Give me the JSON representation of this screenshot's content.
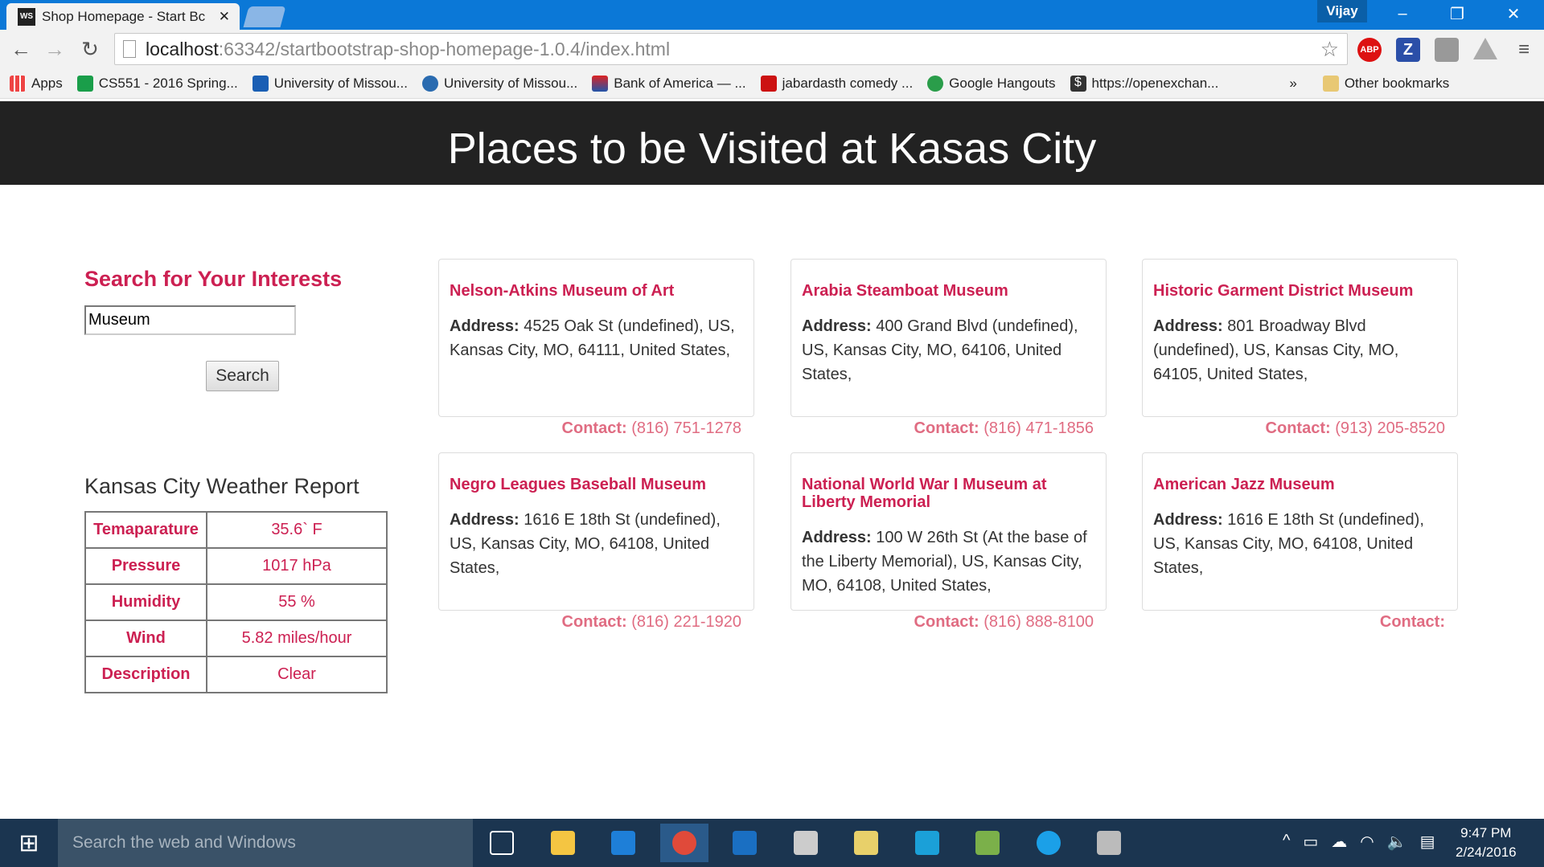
{
  "browser": {
    "tab_title": "Shop Homepage - Start Bc",
    "user": "Vijay",
    "url_host": "localhost",
    "url_path": ":63342/startbootstrap-shop-homepage-1.0.4/index.html",
    "bookmarks": [
      {
        "label": "Apps",
        "color": "#e44"
      },
      {
        "label": "CS551 - 2016 Spring...",
        "color": "#1a9e4a"
      },
      {
        "label": "University of Missou...",
        "color": "#1a5fb4"
      },
      {
        "label": "University of Missou...",
        "color": "#2a6bb0"
      },
      {
        "label": "Bank of America — ...",
        "color": "#d22"
      },
      {
        "label": "jabardasth comedy ...",
        "color": "#c11"
      },
      {
        "label": "Google Hangouts",
        "color": "#2a9d4a"
      },
      {
        "label": "https://openexchan...",
        "color": "#333"
      }
    ],
    "other_bookmarks": "Other bookmarks",
    "extensions": [
      "ABP",
      "Z"
    ]
  },
  "page": {
    "title": "Places to be Visited at Kasas City",
    "search": {
      "heading": "Search for Your Interests",
      "value": "Museum",
      "button": "Search"
    },
    "weather": {
      "heading": "Kansas City Weather Report",
      "rows": [
        [
          "Temaparature",
          "35.6` F"
        ],
        [
          "Pressure",
          "1017 hPa"
        ],
        [
          "Humidity",
          "55 %"
        ],
        [
          "Wind",
          "5.82 miles/hour"
        ],
        [
          "Description",
          "Clear"
        ]
      ]
    },
    "address_label": "Address:",
    "contact_label": "Contact:",
    "places": [
      {
        "name": "Nelson-Atkins Museum of Art",
        "address": "4525 Oak St (undefined), US, Kansas City, MO, 64111, United States,",
        "phone": "(816) 751-1278"
      },
      {
        "name": "Arabia Steamboat Museum",
        "address": "400 Grand Blvd (undefined), US, Kansas City, MO, 64106, United States,",
        "phone": "(816) 471-1856"
      },
      {
        "name": "Historic Garment District Museum",
        "address": "801 Broadway Blvd (undefined), US, Kansas City, MO, 64105, United States,",
        "phone": "(913) 205-8520"
      },
      {
        "name": "Negro Leagues Baseball Museum",
        "address": "1616 E 18th St (undefined), US, Kansas City, MO, 64108, United States,",
        "phone": "(816) 221-1920"
      },
      {
        "name": "National World War I Museum at Liberty Memorial",
        "address": "100 W 26th St (At the base of the Liberty Memorial), US, Kansas City, MO, 64108, United States,",
        "phone": "(816) 888-8100"
      },
      {
        "name": "American Jazz Museum",
        "address": "1616 E 18th St (undefined), US, Kansas City, MO, 64108, United States,",
        "phone": ""
      }
    ]
  },
  "taskbar": {
    "search_placeholder": "Search the web and Windows",
    "time": "9:47 PM",
    "date": "2/24/2016",
    "apps": [
      "task-view",
      "file-explorer",
      "edge",
      "chrome",
      "outlook",
      "snipping-tool",
      "sticky-notes",
      "webstorm",
      "notepad",
      "skype",
      "performance-monitor"
    ]
  }
}
